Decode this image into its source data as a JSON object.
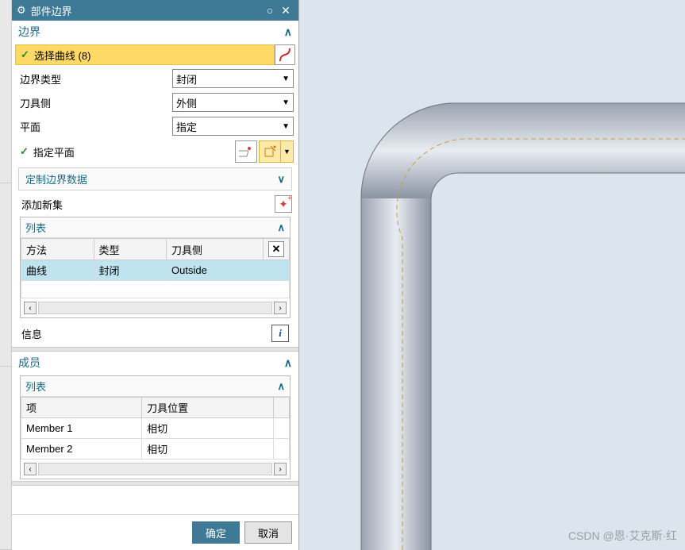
{
  "window": {
    "title": "部件边界"
  },
  "boundary": {
    "header": "边界",
    "select_curve": "选择曲线 (8)",
    "boundary_type_label": "边界类型",
    "boundary_type_value": "封闭",
    "tool_side_label": "刀具侧",
    "tool_side_value": "外侧",
    "plane_label": "平面",
    "plane_value": "指定",
    "spec_plane": "指定平面",
    "custom_data": "定制边界数据",
    "add_new": "添加新集",
    "list_label": "列表",
    "table": {
      "col_method": "方法",
      "col_type": "类型",
      "col_tool_side": "刀具侧",
      "row1": {
        "method": "曲线",
        "type": "封闭",
        "side": "Outside"
      }
    },
    "info_label": "信息"
  },
  "members": {
    "header": "成员",
    "list_label": "列表",
    "col_item": "项",
    "col_tool_pos": "刀具位置",
    "rows": [
      {
        "item": "Member 1",
        "pos": "相切"
      },
      {
        "item": "Member 2",
        "pos": "相切"
      }
    ]
  },
  "buttons": {
    "ok": "确定",
    "cancel": "取消"
  },
  "watermark": "CSDN @恩·艾克斯·红"
}
